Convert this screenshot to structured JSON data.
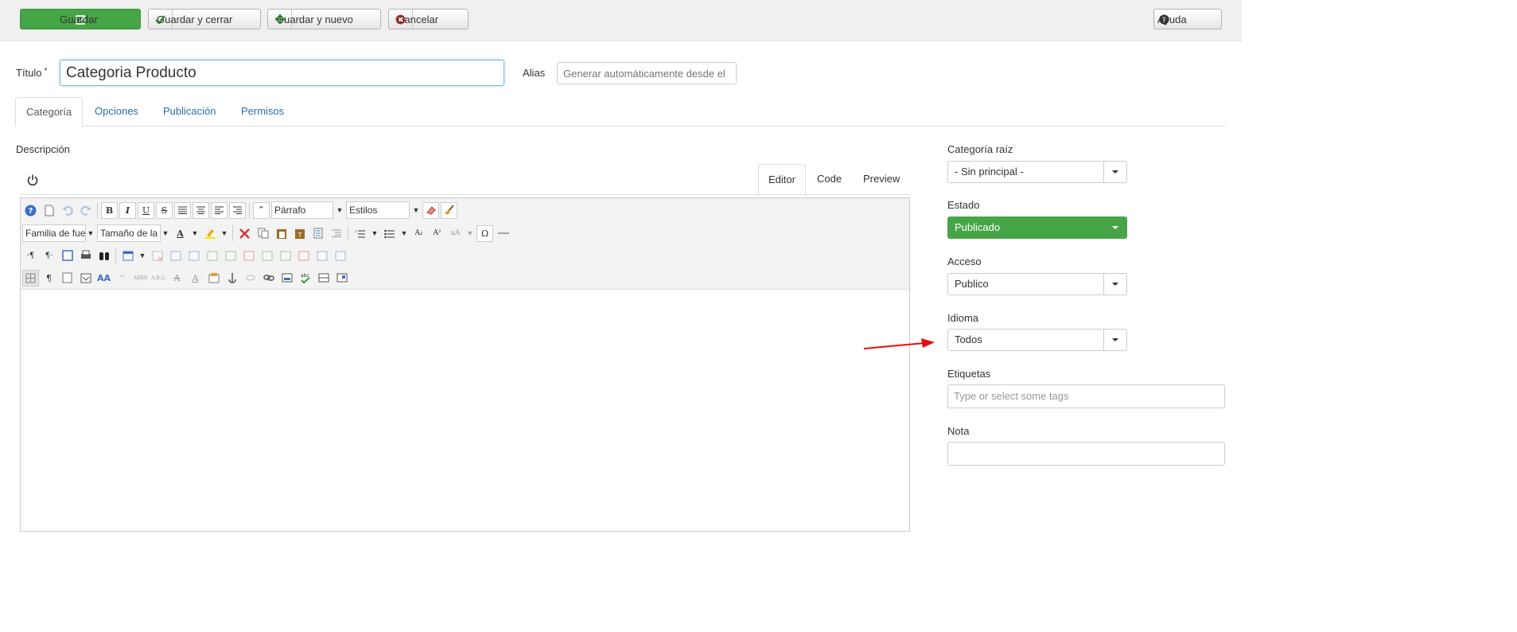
{
  "toolbar": {
    "save": "Guardar",
    "save_close": "Guardar y cerrar",
    "save_new": "Guardar y nuevo",
    "cancel": "Cancelar",
    "help": "Ayuda"
  },
  "title": {
    "label": "Título",
    "required_mark": "*",
    "value": "Categoria Producto"
  },
  "alias": {
    "label": "Alias",
    "placeholder": "Generar automáticamente desde el"
  },
  "tabs": [
    "Categoría",
    "Opciones",
    "Publicación",
    "Permisos"
  ],
  "description": {
    "label": "Descripción"
  },
  "editor": {
    "tabs": [
      "Editor",
      "Code",
      "Preview"
    ],
    "format_select": "Párrafo",
    "styles_select": "Estilos",
    "font_family_select": "Familia de fue",
    "font_size_select": "Tamaño de la"
  },
  "sidebar": {
    "parent": {
      "label": "Categoría raíz",
      "value": "- Sin principal -"
    },
    "status": {
      "label": "Estado",
      "value": "Publicado"
    },
    "access": {
      "label": "Acceso",
      "value": "Publico"
    },
    "language": {
      "label": "Idioma",
      "value": "Todos"
    },
    "tags": {
      "label": "Etiquetas",
      "placeholder": "Type or select some tags"
    },
    "note": {
      "label": "Nota",
      "value": ""
    }
  },
  "colors": {
    "primary_green": "#46a546",
    "link_blue": "#2a6fb0",
    "arrow_red": "#e01010"
  }
}
